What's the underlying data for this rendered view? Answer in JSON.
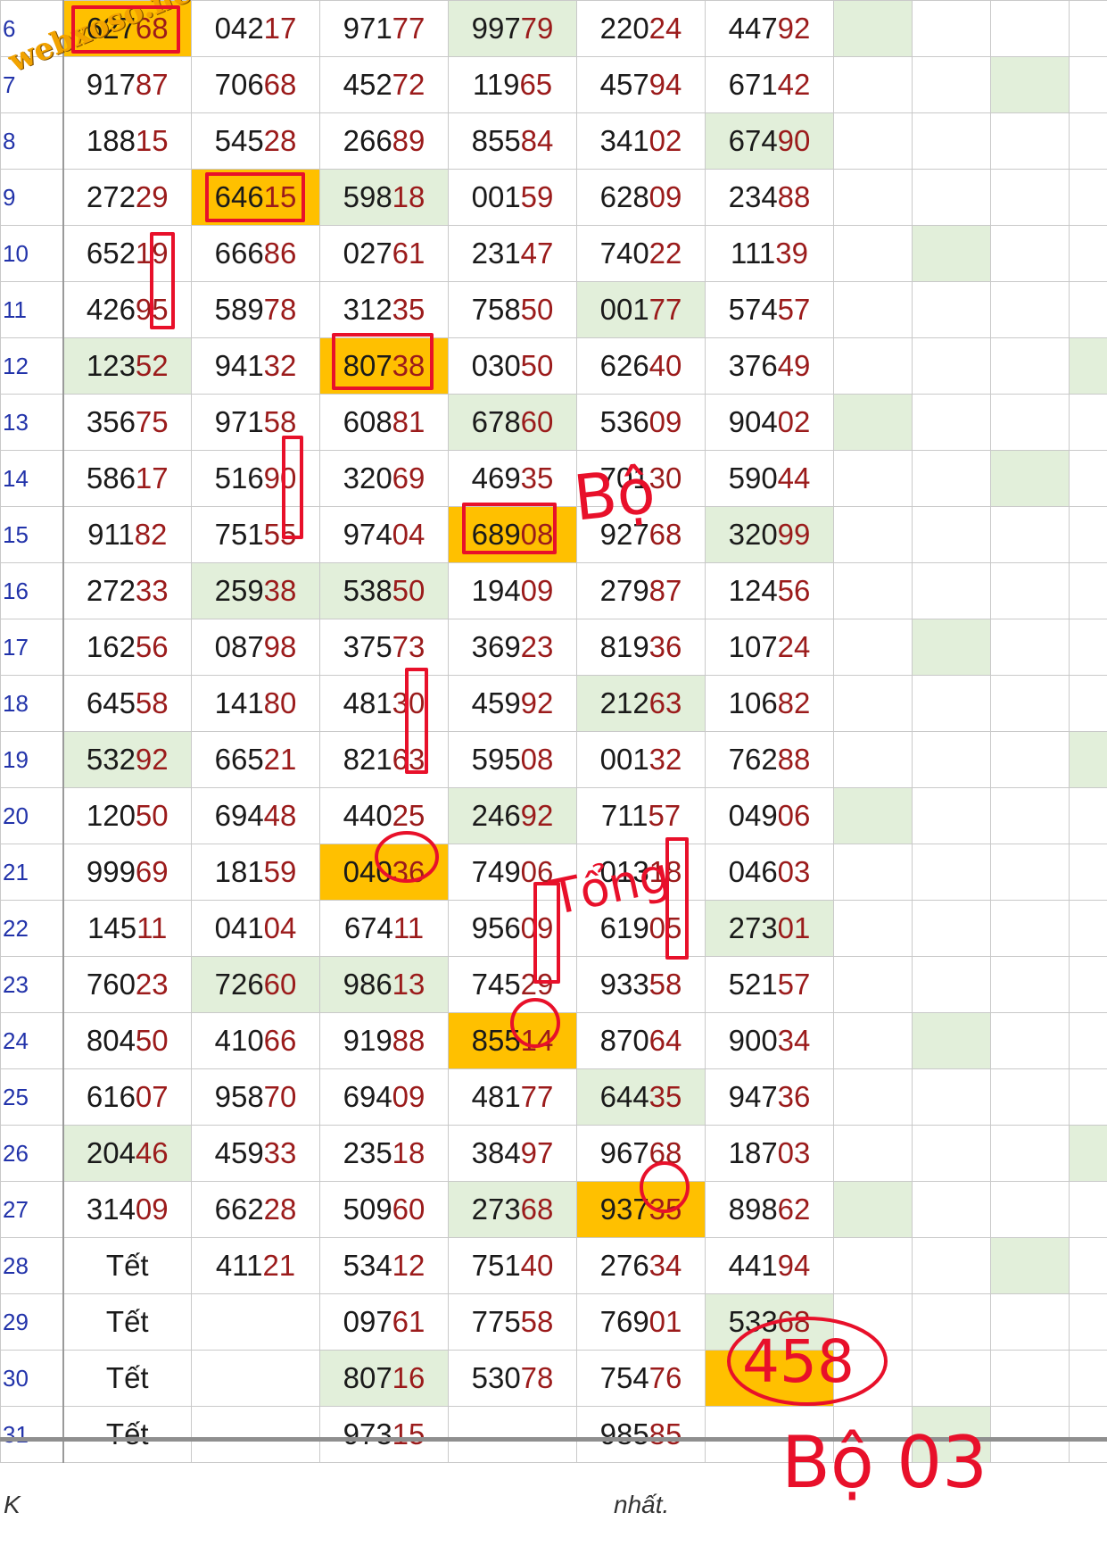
{
  "watermark": "webxoso.net",
  "rows": [
    {
      "num": "6",
      "cells": [
        {
          "v": "62768",
          "hl": "orange"
        },
        {
          "v": "04217"
        },
        {
          "v": "97177"
        },
        {
          "v": "99779",
          "hl": "green"
        },
        {
          "v": "22024"
        },
        {
          "v": "44792"
        },
        {
          "v": "",
          "hl": "green"
        },
        {
          "v": ""
        },
        {
          "v": ""
        },
        {
          "v": ""
        }
      ]
    },
    {
      "num": "7",
      "cells": [
        {
          "v": "91787"
        },
        {
          "v": "70668"
        },
        {
          "v": "45272"
        },
        {
          "v": "11965"
        },
        {
          "v": "45794"
        },
        {
          "v": "67142"
        },
        {
          "v": ""
        },
        {
          "v": ""
        },
        {
          "v": "",
          "hl": "green"
        },
        {
          "v": ""
        }
      ]
    },
    {
      "num": "8",
      "cells": [
        {
          "v": "18815"
        },
        {
          "v": "54528"
        },
        {
          "v": "26689"
        },
        {
          "v": "85584"
        },
        {
          "v": "34102"
        },
        {
          "v": "67490",
          "hl": "green"
        },
        {
          "v": ""
        },
        {
          "v": ""
        },
        {
          "v": ""
        },
        {
          "v": ""
        }
      ]
    },
    {
      "num": "9",
      "cells": [
        {
          "v": "27229"
        },
        {
          "v": "64615",
          "hl": "orange"
        },
        {
          "v": "59818",
          "hl": "green"
        },
        {
          "v": "00159"
        },
        {
          "v": "62809"
        },
        {
          "v": "23488"
        },
        {
          "v": ""
        },
        {
          "v": ""
        },
        {
          "v": ""
        },
        {
          "v": ""
        }
      ]
    },
    {
      "num": "10",
      "cells": [
        {
          "v": "65219"
        },
        {
          "v": "66686"
        },
        {
          "v": "02761"
        },
        {
          "v": "23147"
        },
        {
          "v": "74022"
        },
        {
          "v": "11139"
        },
        {
          "v": ""
        },
        {
          "v": "",
          "hl": "green"
        },
        {
          "v": ""
        },
        {
          "v": ""
        }
      ]
    },
    {
      "num": "11",
      "cells": [
        {
          "v": "42695"
        },
        {
          "v": "58978"
        },
        {
          "v": "31235"
        },
        {
          "v": "75850"
        },
        {
          "v": "00177",
          "hl": "green"
        },
        {
          "v": "57457"
        },
        {
          "v": ""
        },
        {
          "v": ""
        },
        {
          "v": ""
        },
        {
          "v": ""
        }
      ]
    },
    {
      "num": "12",
      "cells": [
        {
          "v": "12352",
          "hl": "green"
        },
        {
          "v": "94132"
        },
        {
          "v": "80738",
          "hl": "orange"
        },
        {
          "v": "03050"
        },
        {
          "v": "62640"
        },
        {
          "v": "37649"
        },
        {
          "v": ""
        },
        {
          "v": ""
        },
        {
          "v": ""
        },
        {
          "v": "",
          "hl": "green"
        }
      ]
    },
    {
      "num": "13",
      "cells": [
        {
          "v": "35675"
        },
        {
          "v": "97158"
        },
        {
          "v": "60881"
        },
        {
          "v": "67860",
          "hl": "green"
        },
        {
          "v": "53609"
        },
        {
          "v": "90402"
        },
        {
          "v": "",
          "hl": "green"
        },
        {
          "v": ""
        },
        {
          "v": ""
        },
        {
          "v": ""
        }
      ]
    },
    {
      "num": "14",
      "cells": [
        {
          "v": "58617"
        },
        {
          "v": "51690"
        },
        {
          "v": "32069"
        },
        {
          "v": "46935"
        },
        {
          "v": "70130"
        },
        {
          "v": "59044"
        },
        {
          "v": ""
        },
        {
          "v": ""
        },
        {
          "v": "",
          "hl": "green"
        },
        {
          "v": ""
        }
      ]
    },
    {
      "num": "15",
      "cells": [
        {
          "v": "91182"
        },
        {
          "v": "75155"
        },
        {
          "v": "97404"
        },
        {
          "v": "68908",
          "hl": "orange"
        },
        {
          "v": "92768"
        },
        {
          "v": "32099",
          "hl": "green"
        },
        {
          "v": ""
        },
        {
          "v": ""
        },
        {
          "v": ""
        },
        {
          "v": ""
        }
      ]
    },
    {
      "num": "16",
      "cells": [
        {
          "v": "27233"
        },
        {
          "v": "25938",
          "hl": "green"
        },
        {
          "v": "53850",
          "hl": "green"
        },
        {
          "v": "19409"
        },
        {
          "v": "27987"
        },
        {
          "v": "12456"
        },
        {
          "v": ""
        },
        {
          "v": ""
        },
        {
          "v": ""
        },
        {
          "v": ""
        }
      ]
    },
    {
      "num": "17",
      "cells": [
        {
          "v": "16256"
        },
        {
          "v": "08798"
        },
        {
          "v": "37573"
        },
        {
          "v": "36923"
        },
        {
          "v": "81936"
        },
        {
          "v": "10724"
        },
        {
          "v": ""
        },
        {
          "v": "",
          "hl": "green"
        },
        {
          "v": ""
        },
        {
          "v": ""
        }
      ]
    },
    {
      "num": "18",
      "cells": [
        {
          "v": "64558"
        },
        {
          "v": "14180"
        },
        {
          "v": "48130"
        },
        {
          "v": "45992"
        },
        {
          "v": "21263",
          "hl": "green"
        },
        {
          "v": "10682"
        },
        {
          "v": ""
        },
        {
          "v": ""
        },
        {
          "v": ""
        },
        {
          "v": ""
        }
      ]
    },
    {
      "num": "19",
      "cells": [
        {
          "v": "53292",
          "hl": "green"
        },
        {
          "v": "66521"
        },
        {
          "v": "82163"
        },
        {
          "v": "59508"
        },
        {
          "v": "00132"
        },
        {
          "v": "76288"
        },
        {
          "v": ""
        },
        {
          "v": ""
        },
        {
          "v": ""
        },
        {
          "v": "",
          "hl": "green"
        }
      ]
    },
    {
      "num": "20",
      "cells": [
        {
          "v": "12050"
        },
        {
          "v": "69448"
        },
        {
          "v": "44025"
        },
        {
          "v": "24692",
          "hl": "green"
        },
        {
          "v": "71157"
        },
        {
          "v": "04906"
        },
        {
          "v": "",
          "hl": "green"
        },
        {
          "v": ""
        },
        {
          "v": ""
        },
        {
          "v": ""
        }
      ]
    },
    {
      "num": "21",
      "cells": [
        {
          "v": "99969"
        },
        {
          "v": "18159"
        },
        {
          "v": "04036",
          "hl": "orange"
        },
        {
          "v": "74906"
        },
        {
          "v": "01318"
        },
        {
          "v": "04603"
        },
        {
          "v": ""
        },
        {
          "v": ""
        },
        {
          "v": ""
        },
        {
          "v": ""
        }
      ]
    },
    {
      "num": "22",
      "cells": [
        {
          "v": "14511"
        },
        {
          "v": "04104"
        },
        {
          "v": "67411"
        },
        {
          "v": "95609"
        },
        {
          "v": "61905"
        },
        {
          "v": "27301",
          "hl": "green"
        },
        {
          "v": ""
        },
        {
          "v": ""
        },
        {
          "v": ""
        },
        {
          "v": ""
        }
      ]
    },
    {
      "num": "23",
      "cells": [
        {
          "v": "76023"
        },
        {
          "v": "72660",
          "hl": "green"
        },
        {
          "v": "98613",
          "hl": "green"
        },
        {
          "v": "74529"
        },
        {
          "v": "93358"
        },
        {
          "v": "52157"
        },
        {
          "v": ""
        },
        {
          "v": ""
        },
        {
          "v": ""
        },
        {
          "v": ""
        }
      ]
    },
    {
      "num": "24",
      "cells": [
        {
          "v": "80450"
        },
        {
          "v": "41066"
        },
        {
          "v": "91988"
        },
        {
          "v": "85514",
          "hl": "orange"
        },
        {
          "v": "87064"
        },
        {
          "v": "90034"
        },
        {
          "v": ""
        },
        {
          "v": "",
          "hl": "green"
        },
        {
          "v": ""
        },
        {
          "v": ""
        }
      ]
    },
    {
      "num": "25",
      "cells": [
        {
          "v": "61607"
        },
        {
          "v": "95870"
        },
        {
          "v": "69409"
        },
        {
          "v": "48177"
        },
        {
          "v": "64435",
          "hl": "green"
        },
        {
          "v": "94736"
        },
        {
          "v": ""
        },
        {
          "v": ""
        },
        {
          "v": ""
        },
        {
          "v": ""
        }
      ]
    },
    {
      "num": "26",
      "cells": [
        {
          "v": "20446",
          "hl": "green"
        },
        {
          "v": "45933"
        },
        {
          "v": "23518"
        },
        {
          "v": "38497"
        },
        {
          "v": "96768"
        },
        {
          "v": "18703"
        },
        {
          "v": ""
        },
        {
          "v": ""
        },
        {
          "v": ""
        },
        {
          "v": "",
          "hl": "green"
        }
      ]
    },
    {
      "num": "27",
      "cells": [
        {
          "v": "31409"
        },
        {
          "v": "66228"
        },
        {
          "v": "50960"
        },
        {
          "v": "27368",
          "hl": "green"
        },
        {
          "v": "93735",
          "hl": "orange"
        },
        {
          "v": "89862"
        },
        {
          "v": "",
          "hl": "green"
        },
        {
          "v": ""
        },
        {
          "v": ""
        },
        {
          "v": ""
        }
      ]
    },
    {
      "num": "28",
      "cells": [
        {
          "v": "Tết"
        },
        {
          "v": "41121"
        },
        {
          "v": "53412"
        },
        {
          "v": "75140"
        },
        {
          "v": "27634"
        },
        {
          "v": "44194"
        },
        {
          "v": ""
        },
        {
          "v": ""
        },
        {
          "v": "",
          "hl": "green"
        },
        {
          "v": ""
        }
      ]
    },
    {
      "num": "29",
      "cells": [
        {
          "v": "Tết"
        },
        {
          "v": ""
        },
        {
          "v": "09761"
        },
        {
          "v": "77558"
        },
        {
          "v": "76901"
        },
        {
          "v": "53368",
          "hl": "green"
        },
        {
          "v": ""
        },
        {
          "v": ""
        },
        {
          "v": ""
        },
        {
          "v": ""
        }
      ]
    },
    {
      "num": "30",
      "cells": [
        {
          "v": "Tết"
        },
        {
          "v": ""
        },
        {
          "v": "80716",
          "hl": "green"
        },
        {
          "v": "53078"
        },
        {
          "v": "75476"
        },
        {
          "v": "",
          "hl": "orange"
        },
        {
          "v": ""
        },
        {
          "v": ""
        },
        {
          "v": ""
        },
        {
          "v": ""
        }
      ]
    },
    {
      "num": "31",
      "cells": [
        {
          "v": "Tết"
        },
        {
          "v": ""
        },
        {
          "v": "97315"
        },
        {
          "v": ""
        },
        {
          "v": "98585"
        },
        {
          "v": ""
        },
        {
          "v": ""
        },
        {
          "v": "",
          "hl": "green"
        },
        {
          "v": ""
        },
        {
          "v": ""
        }
      ]
    }
  ],
  "annotations": {
    "note_bo": "Bộ",
    "note_tong": "Tổng",
    "circled_number": "458",
    "bottom_note": "Bộ 03"
  },
  "footer": {
    "left_fragment": "K",
    "right_fragment": "nhất."
  },
  "colors": {
    "green_cell": "#e2efda",
    "orange_cell": "#ffc000",
    "annotation_red": "#e8102a",
    "row_number_blue": "#2233aa",
    "digit_tail": "#9b1b1b"
  }
}
